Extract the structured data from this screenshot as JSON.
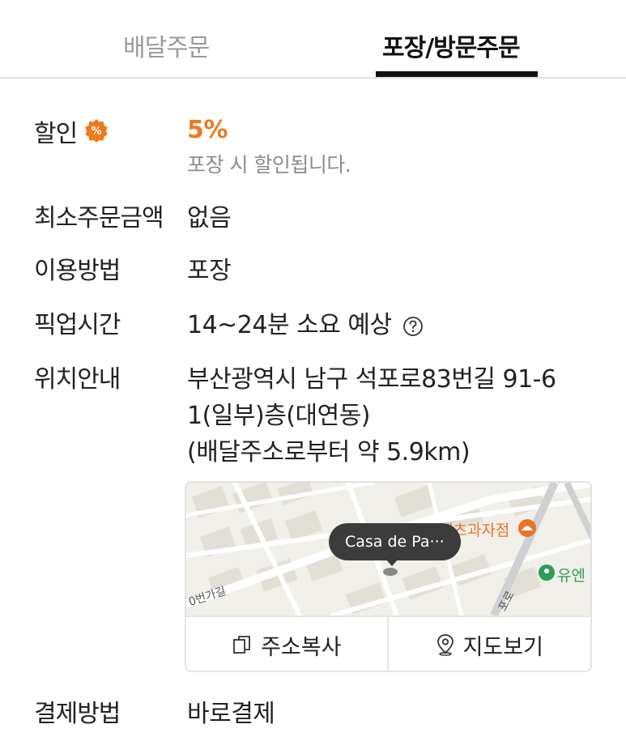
{
  "tabs": {
    "delivery": "배달주문",
    "pickup": "포장/방문주문",
    "active": "pickup"
  },
  "discount": {
    "label": "할인",
    "badge_icon": "percent-badge-icon",
    "value": "5%",
    "note": "포장 시 할인됩니다."
  },
  "min_order": {
    "label": "최소주문금액",
    "value": "없음"
  },
  "usage": {
    "label": "이용방법",
    "value": "포장"
  },
  "pickup_time": {
    "label": "픽업시간",
    "value": "14~24분 소요 예상",
    "help_icon": "question-circle-icon"
  },
  "location": {
    "label": "위치안내",
    "address_line1": "부산광역시 남구 석포로83번길 91-6",
    "address_line2": "1(일부)층(대연동)",
    "distance": "(배달주소로부터 약 5.9km)"
  },
  "map": {
    "store_bubble": "Casa de Pa···",
    "poi_bakery": "제츠과자점",
    "poi_other": "유엔",
    "road_label": "0번가길",
    "road_label2": "포로",
    "copy_button": "주소복사",
    "view_button": "지도보기"
  },
  "payment": {
    "label": "결제방법",
    "value": "바로결제"
  },
  "colors": {
    "accent": "#ee7a1c",
    "tab_active": "#111111",
    "tab_inactive": "#9a9a9a"
  }
}
